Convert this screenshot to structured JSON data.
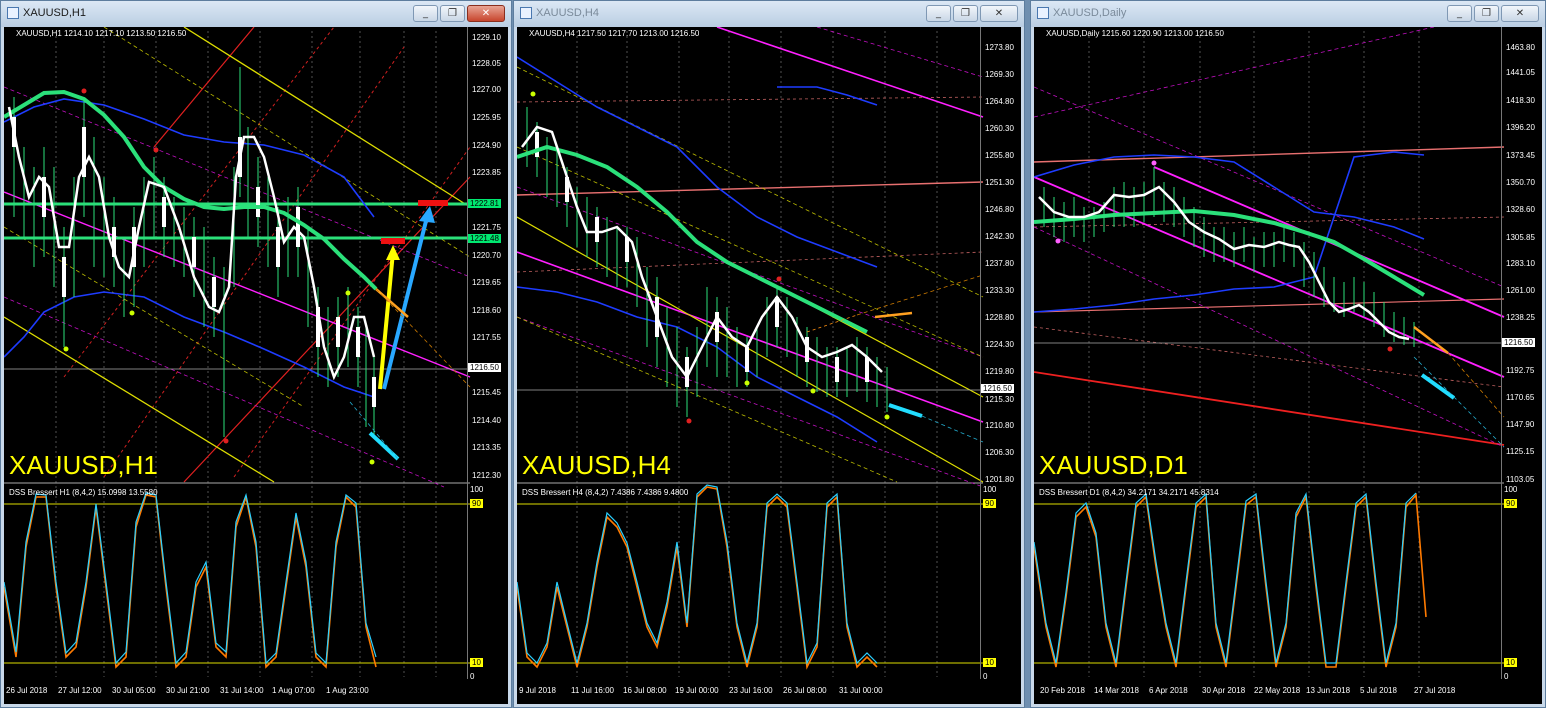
{
  "windows": [
    {
      "title": "XAUUSD,H1",
      "ohlc": "XAUUSD,H1  1214.10 1217.10 1213.50 1216.50",
      "big_label": "XAUUSD,H1",
      "indicator": "DSS Bressert H1 (8,4,2) 15.0998 13.5580",
      "current_price": "1216.50",
      "line_labels": [
        "1222.81",
        "1221.48"
      ],
      "price_labels": [
        "1229.10",
        "1228.05",
        "1227.00",
        "1225.95",
        "1224.90",
        "1223.85",
        "1222.81",
        "1221.75",
        "1220.70",
        "1219.65",
        "1218.60",
        "1217.55",
        "1216.50",
        "1215.45",
        "1214.40",
        "1213.35",
        "1212.30"
      ],
      "time_labels": [
        "26 Jul 2018",
        "27 Jul 12:00",
        "30 Jul 05:00",
        "30 Jul 21:00",
        "31 Jul 14:00",
        "1 Aug 07:00",
        "1 Aug 23:00"
      ],
      "indicator_levels": [
        "100",
        "90",
        "10",
        "0"
      ]
    },
    {
      "title": "XAUUSD,H4",
      "ohlc": "XAUUSD,H4  1217.50 1217.70 1213.00 1216.50",
      "big_label": "XAUUSD,H4",
      "indicator": "DSS Bressert H4 (8,4,2) 7.4386 7.4386 9.4800",
      "current_price": "1216.50",
      "line_labels": [],
      "price_labels": [
        "1273.80",
        "1269.30",
        "1264.80",
        "1260.30",
        "1255.80",
        "1251.30",
        "1246.80",
        "1242.30",
        "1237.80",
        "1233.30",
        "1228.80",
        "1224.30",
        "1219.80",
        "1215.30",
        "1210.80",
        "1206.30",
        "1201.80"
      ],
      "time_labels": [
        "9 Jul 2018",
        "11 Jul 16:00",
        "16 Jul 08:00",
        "19 Jul 00:00",
        "23 Jul 16:00",
        "26 Jul 08:00",
        "31 Jul 00:00"
      ],
      "indicator_levels": [
        "100",
        "90",
        "10",
        "0"
      ]
    },
    {
      "title": "XAUUSD,Daily",
      "ohlc": "XAUUSD,Daily  1215.60 1220.90 1213.00 1216.50",
      "big_label": "XAUUSD,D1",
      "indicator": "DSS Bressert D1 (8,4,2) 34.2171 34.2171 45.8314",
      "current_price": "1216.50",
      "line_labels": [],
      "price_labels": [
        "1463.80",
        "1441.05",
        "1418.30",
        "1396.20",
        "1373.45",
        "1350.70",
        "1328.60",
        "1305.85",
        "1283.10",
        "1261.00",
        "1238.25",
        "1216.50",
        "1192.75",
        "1170.65",
        "1147.90",
        "1125.15",
        "1103.05"
      ],
      "time_labels": [
        "20 Feb 2018",
        "14 Mar 2018",
        "6 Apr 2018",
        "30 Apr 2018",
        "22 May 2018",
        "13 Jun 2018",
        "5 Jul 2018",
        "27 Jul 2018"
      ],
      "indicator_levels": [
        "100",
        "90",
        "10",
        "0"
      ]
    }
  ],
  "window_buttons": {
    "minimize": "_",
    "restore": "❐",
    "close": "✕"
  },
  "colors": {
    "ema": "#2be07a",
    "price_line": "#ffffff",
    "bands": "#1e3cff",
    "channel": "#ffff00",
    "mid": "#ff20ff",
    "resistance": "#e87070",
    "dss_fast": "#2ad0ff",
    "dss_slow": "#ff7a00"
  }
}
